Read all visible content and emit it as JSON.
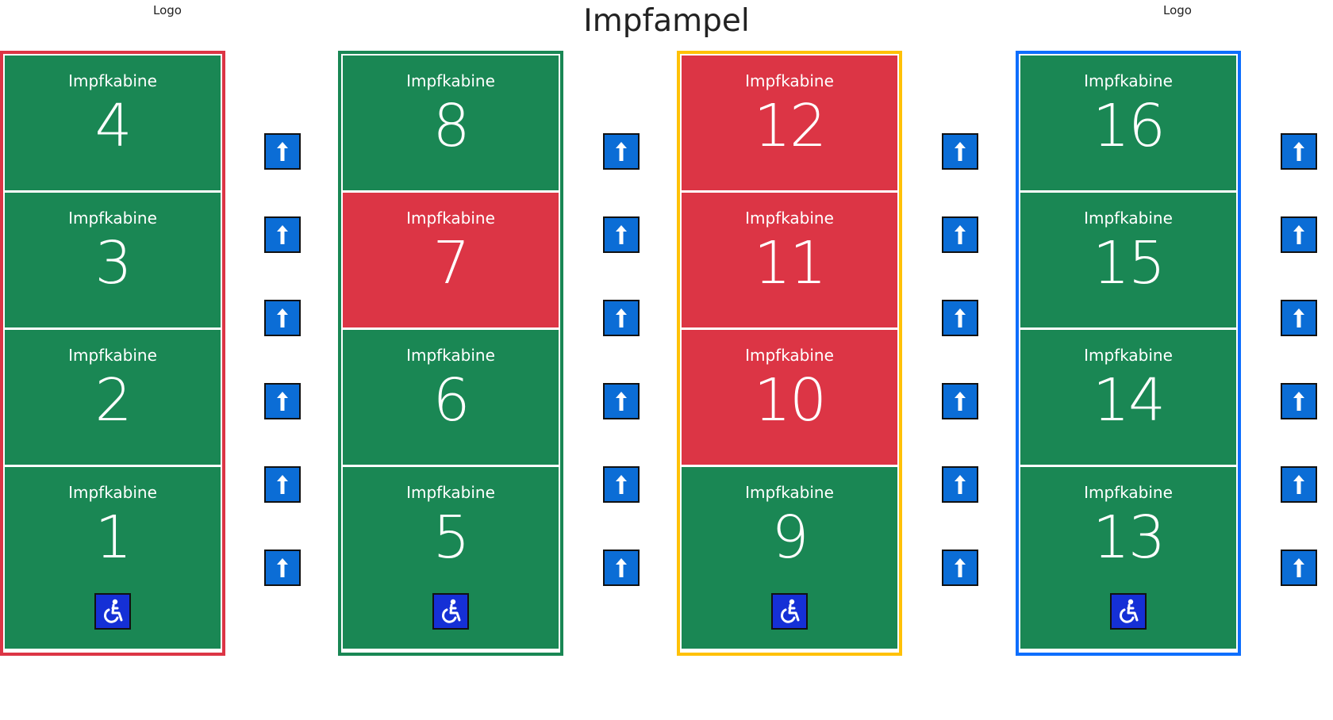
{
  "header": {
    "logo_left": "Logo",
    "title": "Impfampel",
    "logo_right": "Logo"
  },
  "colors": {
    "green": "#1a8754",
    "red": "#dc3545",
    "border_red": "#dc3545",
    "border_green": "#198754",
    "border_yellow": "#ffc107",
    "border_blue": "#0d6efd",
    "arrow_blue": "#0b6dd6",
    "wheelchair_blue": "#1530d6"
  },
  "groups": [
    {
      "border": "red",
      "cabins": [
        {
          "label": "Impfkabine",
          "number": "4",
          "status": "green"
        },
        {
          "label": "Impfkabine",
          "number": "3",
          "status": "green"
        },
        {
          "label": "Impfkabine",
          "number": "2",
          "status": "green"
        },
        {
          "label": "Impfkabine",
          "number": "1",
          "status": "green",
          "accessible": true
        }
      ]
    },
    {
      "border": "green",
      "cabins": [
        {
          "label": "Impfkabine",
          "number": "8",
          "status": "green"
        },
        {
          "label": "Impfkabine",
          "number": "7",
          "status": "red"
        },
        {
          "label": "Impfkabine",
          "number": "6",
          "status": "green"
        },
        {
          "label": "Impfkabine",
          "number": "5",
          "status": "green",
          "accessible": true
        }
      ]
    },
    {
      "border": "yellow",
      "cabins": [
        {
          "label": "Impfkabine",
          "number": "12",
          "status": "red"
        },
        {
          "label": "Impfkabine",
          "number": "11",
          "status": "red"
        },
        {
          "label": "Impfkabine",
          "number": "10",
          "status": "red"
        },
        {
          "label": "Impfkabine",
          "number": "9",
          "status": "green",
          "accessible": true
        }
      ]
    },
    {
      "border": "blue",
      "cabins": [
        {
          "label": "Impfkabine",
          "number": "16",
          "status": "green"
        },
        {
          "label": "Impfkabine",
          "number": "15",
          "status": "green"
        },
        {
          "label": "Impfkabine",
          "number": "14",
          "status": "green"
        },
        {
          "label": "Impfkabine",
          "number": "13",
          "status": "green",
          "accessible": true
        }
      ]
    }
  ],
  "icons": {
    "arrow": "arrow-up-icon",
    "wheelchair": "wheelchair-icon"
  }
}
